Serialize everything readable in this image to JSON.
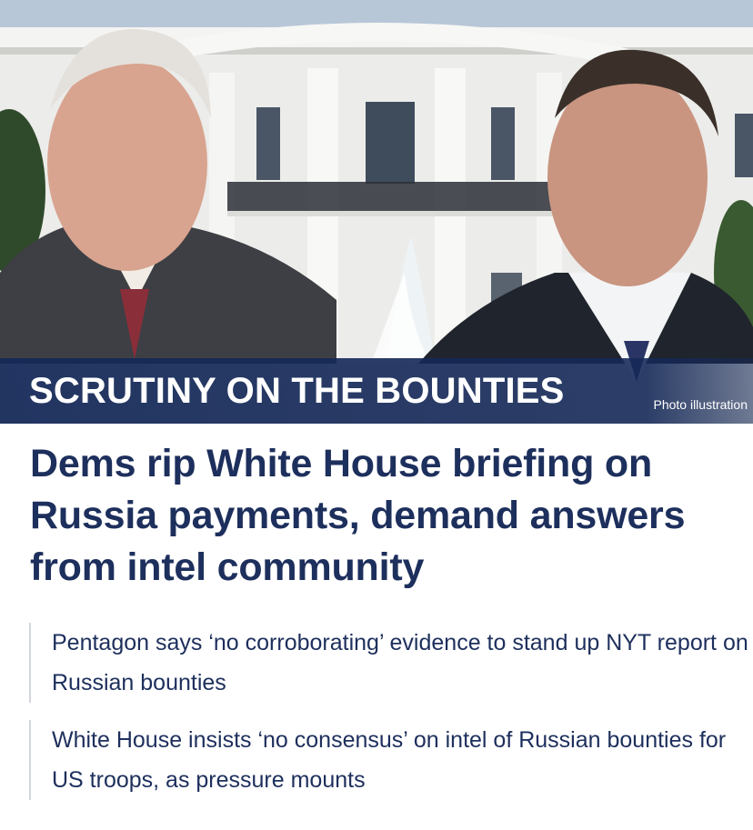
{
  "hero": {
    "banner_title": "SCRUTINY ON THE BOUNTIES",
    "photo_credit": "Photo illustration"
  },
  "article": {
    "headline": "Dems rip White House briefing on Russia payments, demand answers from intel community"
  },
  "related_links": [
    {
      "text": "Pentagon says ‘no corroborating’ evidence to stand up NYT report on Russian bounties"
    },
    {
      "text": "White House insists ‘no consensus’ on intel of Russian bounties for US troops, as pressure mounts"
    }
  ],
  "colors": {
    "navy": "#1d2f5c",
    "banner": "#142858",
    "divider": "#d3d7dd"
  }
}
